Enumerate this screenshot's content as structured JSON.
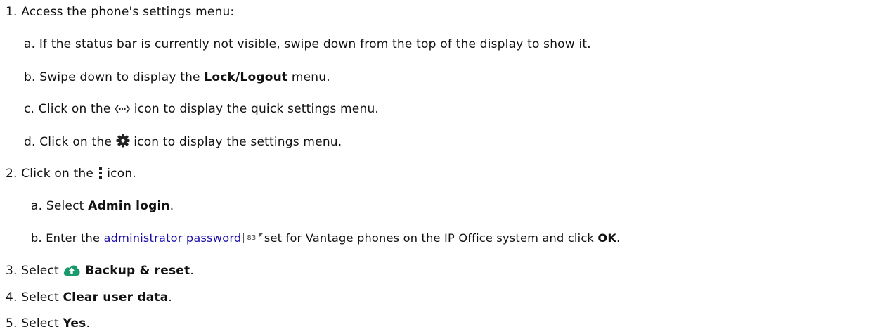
{
  "steps": {
    "s1": {
      "num": "1.",
      "text": "Access the phone's settings menu:",
      "a": {
        "num": "a.",
        "text": "If the status bar is currently not visible, swipe down from the top of the display to show it."
      },
      "b": {
        "num": "b.",
        "pre": "Swipe down to display the ",
        "bold": "Lock/Logout",
        "post": " menu."
      },
      "c": {
        "num": "c.",
        "pre": "Click on the ",
        "icon": "quick-settings-arrows-icon",
        "post": " icon to display the quick settings menu."
      },
      "d": {
        "num": "d.",
        "pre": "Click on the ",
        "icon": "gear-icon",
        "post": " icon to display the settings menu."
      }
    },
    "s2": {
      "num": "2.",
      "pre": "Click on the ",
      "icon": "more-vertical-icon",
      "post": " icon.",
      "a": {
        "num": "a.",
        "pre": "Select ",
        "bold": "Admin login",
        "post": "."
      },
      "b": {
        "num": "b.",
        "pre": "Enter the ",
        "link": "administrator password",
        "page_ref": "83",
        "mid": " set for Vantage phones on the IP Office system and click ",
        "bold": "OK",
        "post": "."
      }
    },
    "s3": {
      "num": "3.",
      "pre": "Select ",
      "icon": "cloud-upload-icon",
      "bold": "Backup & reset",
      "post": "."
    },
    "s4": {
      "num": "4.",
      "pre": "Select ",
      "bold": "Clear user data",
      "post": "."
    },
    "s5": {
      "num": "5.",
      "pre": "Select ",
      "bold": "Yes",
      "post": "."
    }
  },
  "colors": {
    "text": "#111111",
    "link": "#1a0dab",
    "icon_green": "#1a9a6c"
  }
}
